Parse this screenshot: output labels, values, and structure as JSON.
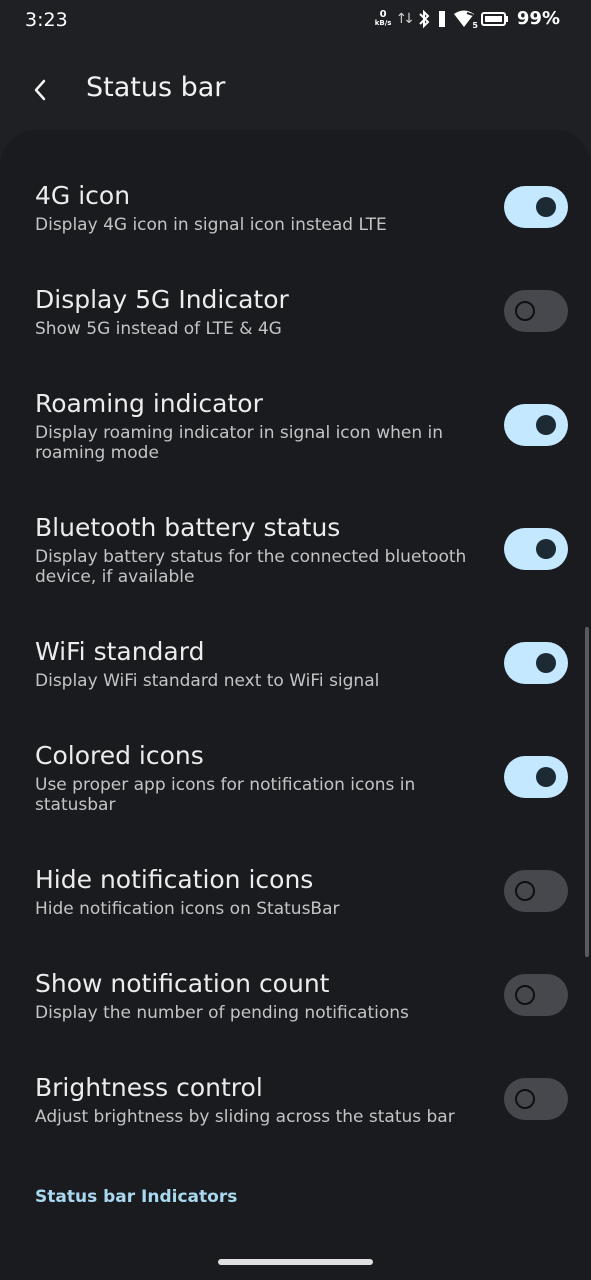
{
  "status_bar": {
    "time": "3:23",
    "net_speed_value": "0",
    "net_speed_unit": "kB/s",
    "wifi_badge": "5",
    "battery_percent": "99%",
    "icons": [
      "data-arrows-icon",
      "bluetooth-icon",
      "signal-icon",
      "wifi-icon",
      "battery-icon"
    ]
  },
  "app_bar": {
    "title": "Status bar",
    "back_icon": "back-arrow-icon"
  },
  "settings": [
    {
      "title": "4G icon",
      "summary": "Display 4G icon in signal icon instead LTE",
      "enabled": true
    },
    {
      "title": "Display 5G Indicator",
      "summary": "Show 5G instead of LTE & 4G",
      "enabled": false
    },
    {
      "title": "Roaming indicator",
      "summary": "Display roaming indicator in signal icon when in roaming mode",
      "enabled": true
    },
    {
      "title": "Bluetooth battery status",
      "summary": "Display battery status for the connected bluetooth device, if available",
      "enabled": true
    },
    {
      "title": "WiFi standard",
      "summary": "Display WiFi standard next to WiFi signal",
      "enabled": true
    },
    {
      "title": "Colored icons",
      "summary": "Use proper app icons for notification icons in statusbar",
      "enabled": true
    },
    {
      "title": "Hide notification icons",
      "summary": "Hide notification icons on StatusBar",
      "enabled": false
    },
    {
      "title": "Show notification count",
      "summary": "Display the number of pending notifications",
      "enabled": false
    },
    {
      "title": "Brightness control",
      "summary": "Adjust brightness by sliding across the status bar",
      "enabled": false
    }
  ],
  "section_header": "Status bar Indicators",
  "colors": {
    "background": "#1f2024",
    "surface": "#1a1b1e",
    "toggle_on": "#c3e8ff",
    "toggle_off": "#46484d",
    "accent_text": "#a8d8f0"
  }
}
